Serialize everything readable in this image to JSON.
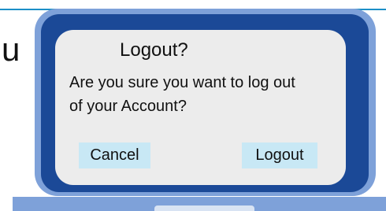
{
  "background": {
    "partial_text": "u"
  },
  "dialog": {
    "title": "Logout?",
    "message": "Are you sure you want to log out of your Account?",
    "cancel_label": "Cancel",
    "logout_label": "Logout"
  },
  "colors": {
    "laptop_frame": "#7ea1d9",
    "screen": "#1b4997",
    "dialog_background": "#ececec",
    "button_background": "#c8e8f5",
    "accent_line": "#1c8fc7"
  }
}
